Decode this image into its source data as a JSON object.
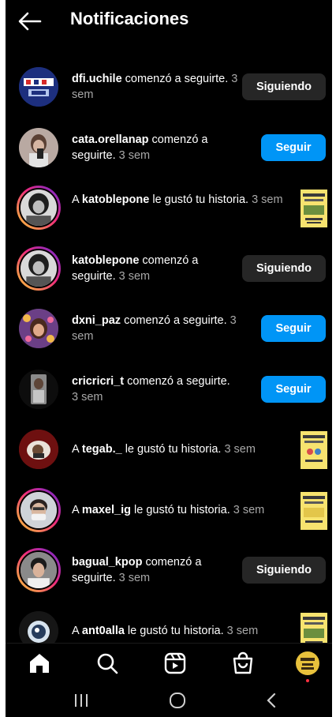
{
  "header": {
    "title": "Notificaciones",
    "back_icon": "arrow-left-icon"
  },
  "notifications": [
    {
      "user": "dfi.uchile",
      "message": " comenzó a seguirte.",
      "time": " 3 sem",
      "action": "Siguiendo"
    },
    {
      "user": "cata.orellanap",
      "message": " comenzó a seguirte.",
      "time": " 3 sem",
      "action": "Seguir"
    },
    {
      "prefix": "A ",
      "user": "katoblepone",
      "message": " le gustó tu historia.",
      "time": " 3 sem"
    },
    {
      "user": "katoblepone",
      "message": " comenzó a seguirte.",
      "time": " 3 sem",
      "action": "Siguiendo"
    },
    {
      "user": "dxni_paz",
      "message": " comenzó a seguirte.",
      "time": " 3 sem",
      "action": "Seguir"
    },
    {
      "user": "cricricri_t",
      "message": " comenzó a seguirte.",
      "time": " 3 sem",
      "action": "Seguir"
    },
    {
      "prefix": "A ",
      "user": "tegab._",
      "message": " le gustó tu historia.",
      "time": " 3 sem"
    },
    {
      "prefix": "A ",
      "user": "maxel_ig",
      "message": " le gustó tu historia.",
      "time": " 3 sem"
    },
    {
      "user": "bagual_kpop",
      "message": " comenzó a seguirte.",
      "time": " 3 sem",
      "action": "Siguiendo"
    },
    {
      "prefix": "A ",
      "user": "ant0alla",
      "message": " le gustó tu historia.",
      "time": " 3 sem"
    }
  ],
  "bottom_nav": {
    "items": [
      "home-icon",
      "search-icon",
      "reels-icon",
      "shop-icon",
      "profile-avatar"
    ]
  },
  "system_nav": {
    "items": [
      "recents-icon",
      "home-circle-icon",
      "back-chevron-icon"
    ]
  },
  "colors": {
    "background": "#000000",
    "follow_button": "#0095f6",
    "following_button": "#262626",
    "secondary_text": "#a8a8a8",
    "story_ring": "#ee2a7b"
  }
}
